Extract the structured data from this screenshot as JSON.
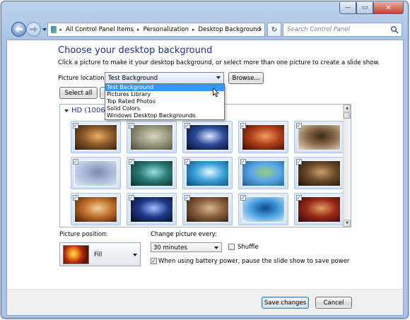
{
  "window": {
    "caption_buttons": {
      "minimize": "—",
      "maximize": "▭",
      "close": "✕"
    }
  },
  "nav": {
    "breadcrumbs": [
      "All Control Panel Items",
      "Personalization",
      "Desktop Background"
    ],
    "separator": "▸",
    "dropdown_glyph": "▾",
    "refresh_glyph": "↻",
    "search_placeholder": "Search Control Panel"
  },
  "main": {
    "title": "Choose your desktop background",
    "subtitle": "Click a picture to make it your desktop background, or select more than one picture to create a slide show.",
    "picture_location_label": "Picture location:",
    "picture_location_value": "Test Background",
    "browse_label": "Browse...",
    "select_all_label": "Select all",
    "location_options": [
      "Test Background",
      "Pictures Library",
      "Top Rated Photos",
      "Solid Colors",
      "Windows Desktop Backgrounds"
    ],
    "selected_option_index": 0
  },
  "gallery": {
    "group_header": "HD (1006)",
    "check_glyph": "✓",
    "scroll_up": "▲",
    "scroll_down": "▼",
    "tiles": [
      {
        "name": "wallpaper-1",
        "checked": true,
        "colors": [
          "#2b1a0e",
          "#8a5a2a",
          "#e8b060"
        ]
      },
      {
        "name": "wallpaper-2",
        "checked": true,
        "colors": [
          "#4a4a3e",
          "#9a9a80",
          "#d9d4b8"
        ]
      },
      {
        "name": "wallpaper-3",
        "checked": true,
        "colors": [
          "#050a20",
          "#2a4a9a",
          "#dfe8ff"
        ]
      },
      {
        "name": "wallpaper-4",
        "checked": true,
        "colors": [
          "#3a0a05",
          "#b0401a",
          "#f0a060"
        ]
      },
      {
        "name": "wallpaper-5",
        "checked": true,
        "colors": [
          "#e8dcc8",
          "#8a6a4a",
          "#3a2a1a"
        ]
      },
      {
        "name": "wallpaper-6",
        "checked": true,
        "colors": [
          "#dfe8f5",
          "#a9b9d6",
          "#7a8ab0"
        ]
      },
      {
        "name": "wallpaper-7",
        "checked": true,
        "colors": [
          "#0a2a2a",
          "#2a7a7a",
          "#9ae0e0"
        ]
      },
      {
        "name": "wallpaper-8",
        "checked": true,
        "colors": [
          "#0a4a7a",
          "#3aa0d8",
          "#e8f6ff"
        ]
      },
      {
        "name": "wallpaper-9",
        "checked": true,
        "colors": [
          "#1a5a9a",
          "#58a8e8",
          "#9ad07a"
        ]
      },
      {
        "name": "wallpaper-10",
        "checked": true,
        "colors": [
          "#1a1208",
          "#6a4a2a",
          "#c8a070"
        ]
      },
      {
        "name": "wallpaper-11",
        "checked": true,
        "colors": [
          "#3a1a0a",
          "#c0702a",
          "#f0d0a0"
        ]
      },
      {
        "name": "wallpaper-12",
        "checked": true,
        "colors": [
          "#05081a",
          "#203a8a",
          "#a0c0ff"
        ]
      },
      {
        "name": "wallpaper-13",
        "checked": true,
        "colors": [
          "#2a1a10",
          "#8a6040",
          "#d8b890"
        ]
      },
      {
        "name": "wallpaper-14",
        "checked": true,
        "colors": [
          "#e8f4ff",
          "#4aa0e0",
          "#0a4a8a"
        ]
      },
      {
        "name": "wallpaper-15",
        "checked": true,
        "colors": [
          "#2a0a0a",
          "#9a2a1a",
          "#e0a060"
        ]
      }
    ]
  },
  "options": {
    "picture_position_label": "Picture position:",
    "picture_position_value": "Fill",
    "change_label": "Change picture every:",
    "change_value": "30 minutes",
    "shuffle_label": "Shuffle",
    "shuffle_checked": false,
    "battery_label": "When using battery power, pause the slide show to save power",
    "battery_checked": true
  },
  "footer": {
    "save_label": "Save changes",
    "cancel_label": "Cancel"
  }
}
